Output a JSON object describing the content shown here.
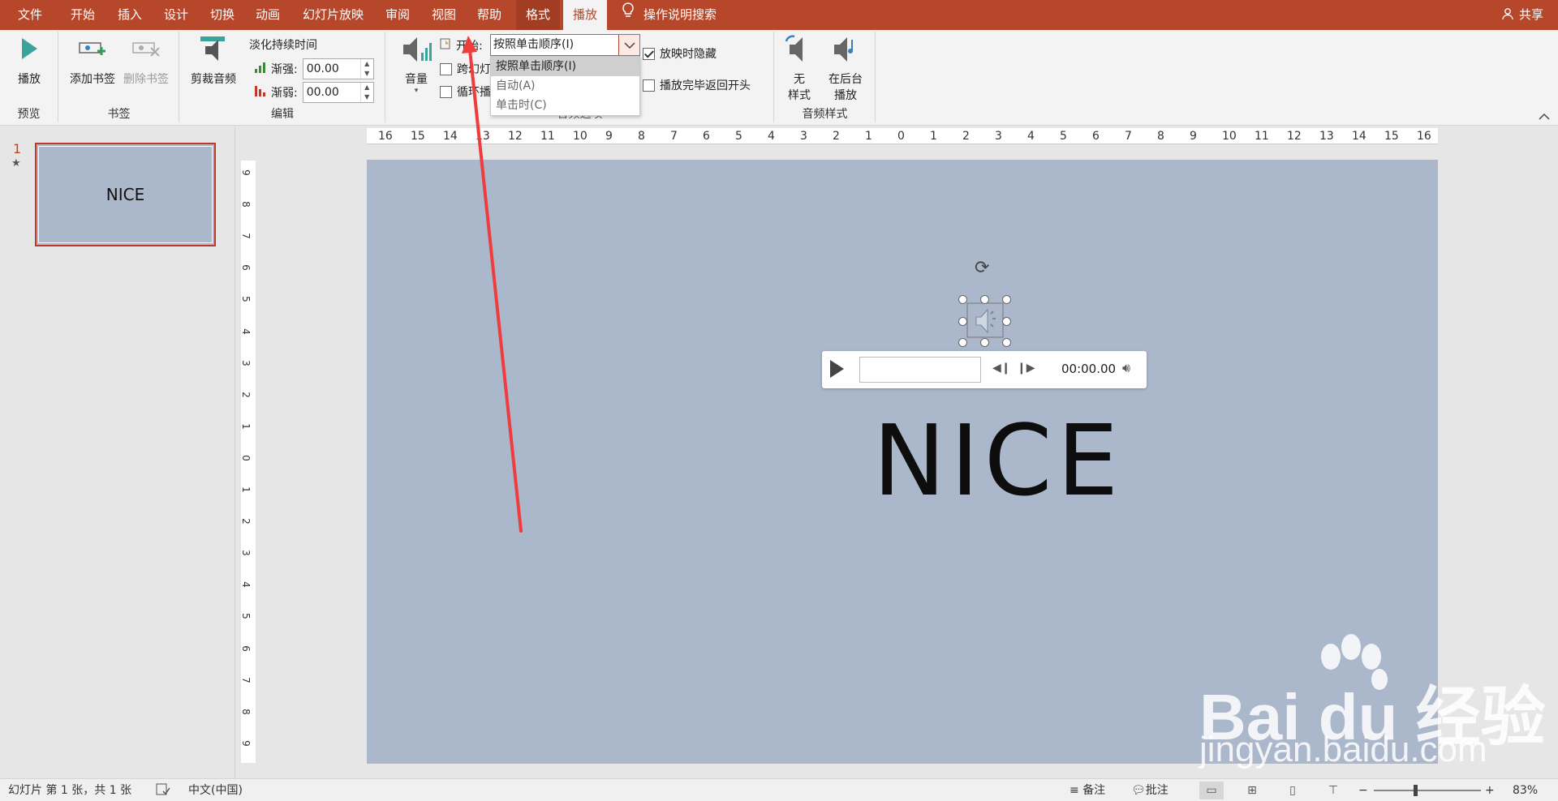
{
  "menubar": {
    "items": [
      "文件",
      "开始",
      "插入",
      "设计",
      "切换",
      "动画",
      "幻灯片放映",
      "审阅",
      "视图",
      "帮助",
      "格式",
      "播放"
    ],
    "help_search": "操作说明搜索",
    "share": "共享"
  },
  "ribbon": {
    "preview": {
      "play_label": "播放",
      "group_label": "预览"
    },
    "bookmarks": {
      "add_label": "添加书签",
      "remove_label": "删除书签",
      "group_label": "书签"
    },
    "editing": {
      "trim_label": "剪裁音频",
      "fade_title": "淡化持续时间",
      "fade_in_label": "渐强:",
      "fade_in_value": "00.00",
      "fade_out_label": "渐弱:",
      "fade_out_value": "00.00",
      "group_label": "编辑"
    },
    "audio_options": {
      "volume_label": "音量",
      "start_label": "开始:",
      "start_value": "按照单击顺序(I)",
      "cross_slides_label": "跨幻灯",
      "loop_label": "循环播",
      "hide_label": "放映时隐藏",
      "rewind_label": "播放完毕返回开头",
      "group_label": "音频选项",
      "dropdown_options": [
        "按照单击顺序(I)",
        "自动(A)",
        "单击时(C)"
      ]
    },
    "audio_styles": {
      "no_style_line1": "无",
      "no_style_line2": "样式",
      "background_line1": "在后台",
      "background_line2": "播放",
      "group_label": "音频样式"
    }
  },
  "slides_panel": {
    "number": "1",
    "thumb_title": "NICE"
  },
  "ruler": {
    "horizontal": [
      "16",
      "15",
      "14",
      "13",
      "12",
      "11",
      "10",
      "9",
      "8",
      "7",
      "6",
      "5",
      "4",
      "3",
      "2",
      "1",
      "0",
      "1",
      "2",
      "3",
      "4",
      "5",
      "6",
      "7",
      "8",
      "9",
      "10",
      "11",
      "12",
      "13",
      "14",
      "15",
      "16"
    ],
    "vertical": [
      "9",
      "8",
      "7",
      "6",
      "5",
      "4",
      "3",
      "2",
      "1",
      "0",
      "1",
      "2",
      "3",
      "4",
      "5",
      "6",
      "7",
      "8",
      "9"
    ]
  },
  "slide": {
    "title": "NICE",
    "player_time": "00:00.00"
  },
  "watermark": {
    "logo": "Bai du 经验",
    "url": "jingyan.baidu.com"
  },
  "statusbar": {
    "slide_info": "幻灯片 第 1 张，共 1 张",
    "language": "中文(中国)",
    "notes": "备注",
    "comments": "批注",
    "zoom": "83%"
  },
  "colors": {
    "accent": "#b7472a",
    "slide_bg": "#abb7cb",
    "ribbon_bg": "#f3f3f3"
  }
}
